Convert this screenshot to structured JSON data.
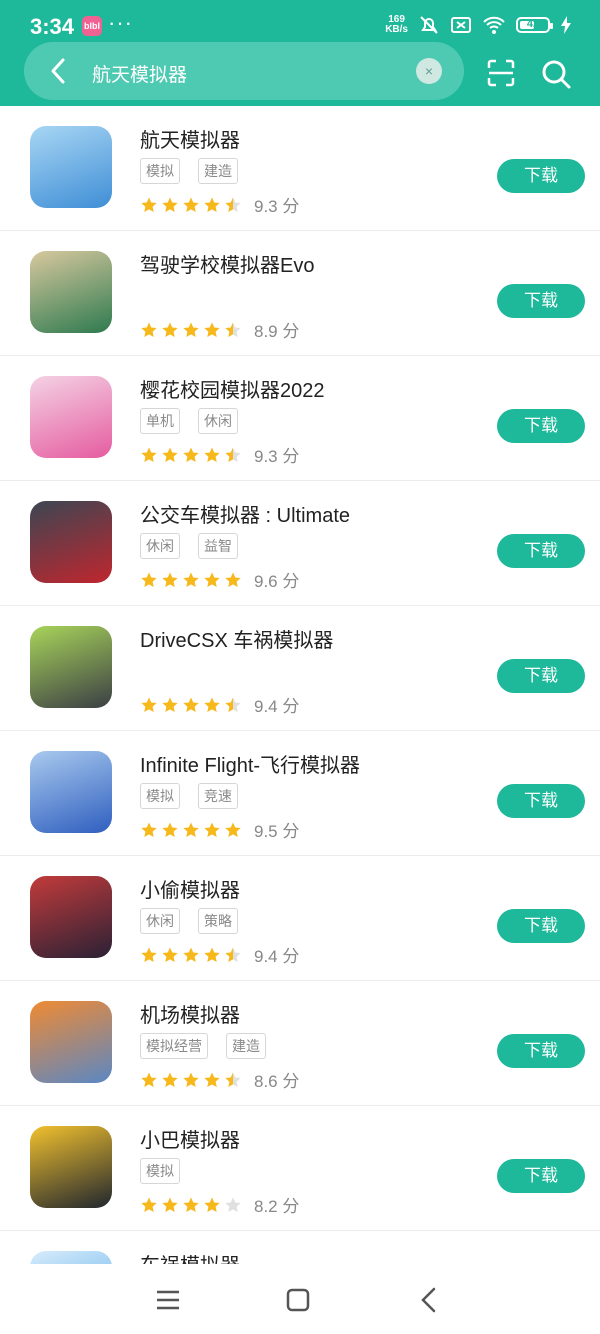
{
  "status_bar": {
    "time": "3:34",
    "app_badge": "blbl",
    "more": "···",
    "speed_top": "169",
    "speed_unit": "KB/s",
    "battery": "42"
  },
  "search": {
    "query": "航天模拟器",
    "clear": "×"
  },
  "download_label": "下载",
  "score_unit": "分",
  "apps": [
    {
      "name": "航天模拟器",
      "tags": [
        "模拟",
        "建造"
      ],
      "rating": 4.5,
      "score": "9.3 分",
      "colors": [
        "#3f8ed6",
        "#a8d6f4"
      ]
    },
    {
      "name": "驾驶学校模拟器Evo",
      "tags": [],
      "rating": 4.5,
      "score": "8.9 分",
      "colors": [
        "#2e7a4f",
        "#d8c89e"
      ]
    },
    {
      "name": "樱花校园模拟器2022",
      "tags": [
        "单机",
        "休闲"
      ],
      "rating": 4.5,
      "score": "9.3 分",
      "colors": [
        "#e55ca0",
        "#f4d2e4"
      ]
    },
    {
      "name": "公交车模拟器 : Ultimate",
      "tags": [
        "休闲",
        "益智"
      ],
      "rating": 5,
      "score": "9.6 分",
      "colors": [
        "#c0262e",
        "#3b4653"
      ]
    },
    {
      "name": "DriveCSX 车祸模拟器",
      "tags": [],
      "rating": 4.5,
      "score": "9.4 分",
      "colors": [
        "#3b3f44",
        "#a8d45a"
      ]
    },
    {
      "name": "Infinite Flight-飞行模拟器",
      "tags": [
        "模拟",
        "竞速"
      ],
      "rating": 5,
      "score": "9.5 分",
      "colors": [
        "#2f5fbf",
        "#a9c9ee"
      ]
    },
    {
      "name": "小偷模拟器",
      "tags": [
        "休闲",
        "策略"
      ],
      "rating": 4.5,
      "score": "9.4 分",
      "colors": [
        "#2a2135",
        "#c23b3b"
      ]
    },
    {
      "name": "机场模拟器",
      "tags": [
        "模拟经营",
        "建造"
      ],
      "rating": 4.5,
      "score": "8.6 分",
      "colors": [
        "#5a87c4",
        "#f08a33"
      ]
    },
    {
      "name": "小巴模拟器",
      "tags": [
        "模拟"
      ],
      "rating": 4,
      "score": "8.2 分",
      "colors": [
        "#20262e",
        "#f2c12e"
      ]
    },
    {
      "name": "车祸模拟器",
      "tags": [],
      "rating": 0,
      "score": "",
      "colors": [
        "#4aa4e8",
        "#d7ecfb"
      ]
    }
  ],
  "icons": {
    "back": "chevron-left-icon",
    "scan": "scan-icon",
    "search": "search-icon",
    "star": "star-icon",
    "menu": "menu-icon",
    "home": "home-icon"
  },
  "theme": {
    "accent": "#1eb89a",
    "star": "#f6b81a",
    "star_empty": "#e0e0e0"
  }
}
